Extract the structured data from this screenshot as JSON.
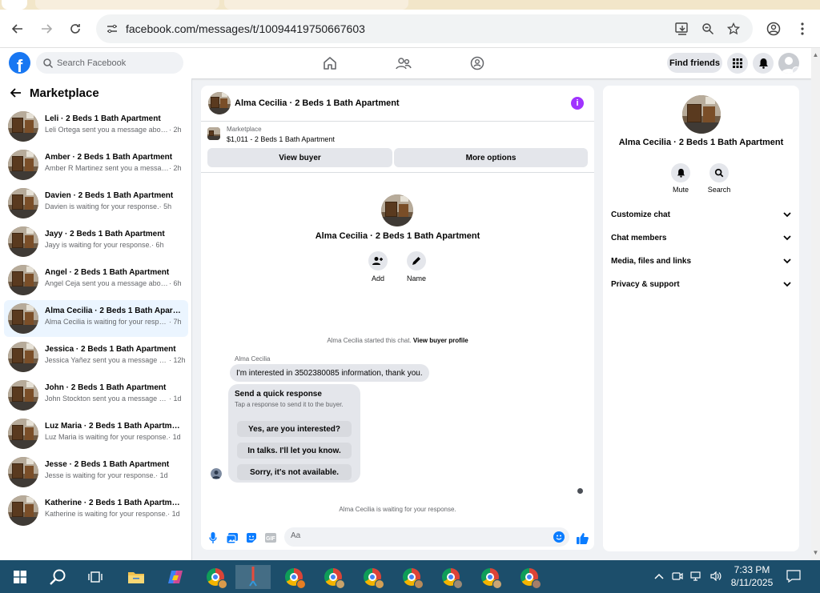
{
  "browser": {
    "url": "facebook.com/messages/t/10094419750667603"
  },
  "fb": {
    "search_placeholder": "Search Facebook",
    "find_friends": "Find friends"
  },
  "sidebar": {
    "title": "Marketplace",
    "conversations": [
      {
        "name": "Leli · 2 Beds 1 Bath Apartment",
        "preview": "Leli Ortega sent you a message about...",
        "time": " · 2h"
      },
      {
        "name": "Amber · 2 Beds 1 Bath Apartment",
        "preview": "Amber R Martinez sent you a messag...",
        "time": " · 2h"
      },
      {
        "name": "Davien · 2 Beds 1 Bath Apartment",
        "preview": "Davien is waiting for your response.",
        "time": " · 5h"
      },
      {
        "name": "Jayy · 2 Beds 1 Bath Apartment",
        "preview": "Jayy is waiting for your response.",
        "time": " · 6h"
      },
      {
        "name": "Angel · 2 Beds 1 Bath Apartment",
        "preview": "Angel Ceja sent you a message about ...",
        "time": " · 6h"
      },
      {
        "name": "Alma Cecilia · 2 Beds 1 Bath Apart...",
        "preview": "Alma Cecilia is waiting for your respo...",
        "time": " · 7h"
      },
      {
        "name": "Jessica · 2 Beds 1 Bath Apartment",
        "preview": "Jessica Yañez sent you a message ab...",
        "time": " · 12h"
      },
      {
        "name": "John · 2 Beds 1 Bath Apartment",
        "preview": "John Stockton sent you a message ab...",
        "time": " · 1d"
      },
      {
        "name": "Luz Maria · 2 Beds 1 Bath Apartment",
        "preview": "Luz Maria is waiting for your response.",
        "time": " · 1d"
      },
      {
        "name": "Jesse · 2 Beds 1 Bath Apartment",
        "preview": "Jesse is waiting for your response.",
        "time": " · 1d"
      },
      {
        "name": "Katherine · 2 Beds 1 Bath Apartment",
        "preview": "Katherine is waiting for your response.",
        "time": " · 1d"
      }
    ]
  },
  "chat": {
    "title": "Alma Cecilia · 2 Beds 1 Bath Apartment",
    "marketplace_label": "Marketplace",
    "listing": "$1,011 - 2 Beds 1 Bath Apartment",
    "view_buyer": "View buyer",
    "more_options": "More options",
    "intro_name": "Alma Cecilia · 2 Beds 1 Bath Apartment",
    "add_label": "Add",
    "name_label": "Name",
    "started_text": "Alma Cecilia started this chat. ",
    "view_buyer_profile": "View buyer profile",
    "sender": "Alma Cecilia",
    "message": "I'm interested in 3502380085 information, thank you.",
    "quick_title": "Send a quick response",
    "quick_sub": "Tap a response to send it to the buyer.",
    "quick_replies": [
      "Yes, are you interested?",
      "In talks. I'll let you know.",
      "Sorry, it's not available."
    ],
    "waiting_text": "Alma Cecilia is waiting for your response.",
    "composer_placeholder": "Aa"
  },
  "details": {
    "name": "Alma Cecilia · 2 Beds 1 Bath Apartment",
    "mute": "Mute",
    "search": "Search",
    "rows": [
      "Customize chat",
      "Chat members",
      "Media, files and links",
      "Privacy & support"
    ]
  },
  "taskbar": {
    "time": "7:33 PM",
    "date": "8/11/2025"
  },
  "colors": {
    "fb_blue": "#1877f2",
    "messenger_blue": "#0a7cff",
    "info_purple": "#a033ff",
    "taskbar": "#1c4e6b"
  }
}
